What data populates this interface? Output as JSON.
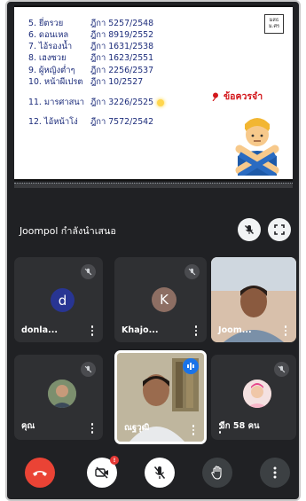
{
  "slide": {
    "rows": [
      {
        "name": "5. ยี่ตรวย",
        "ref": "ฎีกา 5257/2548"
      },
      {
        "name": "6. ดอนเหล",
        "ref": "ฎีกา 8919/2552"
      },
      {
        "name": "7. ไอ้รองน้ำ",
        "ref": "ฎีกา 1631/2538"
      },
      {
        "name": "8. เฮงซวย",
        "ref": "ฎีกา 1623/2551"
      },
      {
        "name": "9. ผู้หญิงต่ำๆ",
        "ref": "ฎีกา 2256/2537"
      },
      {
        "name": "10. หน้าผีเปรต",
        "ref": "ฎีกา 10/2527"
      },
      {
        "name": "11. มารศาสนา",
        "ref": "ฎีกา 3226/2525"
      },
      {
        "name": "12. ไอ้หน้าโง่",
        "ref": "ฎีกา 7572/2542"
      }
    ],
    "reminder": "ข้อควรจำ",
    "logo_line1": "มสธ",
    "logo_line2": "ม.ศร"
  },
  "presenting": {
    "text": "Joompol กำลังนำเสนอ"
  },
  "tiles": [
    {
      "name": "donla...",
      "avatar_letter": "d",
      "avatar_color": "#283593"
    },
    {
      "name": "Khajo...",
      "avatar_letter": "K",
      "avatar_color": "#8d6e63"
    },
    {
      "name": "Joom...",
      "avatar_letter": "",
      "avatar_color": "#8a7060"
    },
    {
      "name": "คุณ",
      "avatar_letter": "",
      "avatar_color": "#6b7d6a"
    },
    {
      "name": "ณฐวุฒิ",
      "avatar_letter": "",
      "avatar_color": "#a09880"
    },
    {
      "name": "อีก 58 คน",
      "avatar_letter": "",
      "avatar_color": "#c98a8a"
    }
  ],
  "controls": {
    "camera_badge": "!"
  }
}
